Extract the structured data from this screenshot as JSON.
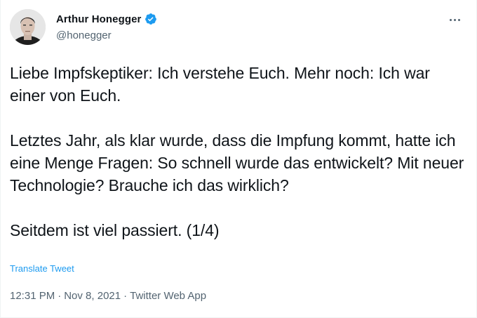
{
  "author": {
    "display_name": "Arthur Honegger",
    "handle": "@honegger",
    "verified": true
  },
  "tweet": {
    "paragraphs": [
      "Liebe Impfskeptiker: Ich verstehe Euch. Mehr noch: Ich war einer von Euch.",
      "Letztes Jahr, als klar wurde, dass die Impfung kommt, hatte ich eine Menge Fragen: So schnell wurde das entwickelt? Mit neuer Technologie? Brauche ich das wirklich?",
      "Seitdem ist viel passiert. (1/4)"
    ],
    "translate_label": "Translate Tweet",
    "time": "12:31 PM",
    "date": "Nov 8, 2021",
    "source": "Twitter Web App",
    "separator": "·"
  },
  "icons": {
    "more": "more-options-icon",
    "verified": "verified-badge-icon"
  },
  "colors": {
    "accent": "#1d9bf0",
    "text": "#0f1419",
    "secondary": "#536471"
  }
}
